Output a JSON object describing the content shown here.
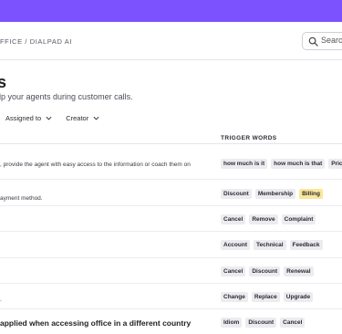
{
  "header": {
    "breadcrumb": "FFICE / DIALPAD AI",
    "search_placeholder": "Search"
  },
  "page": {
    "title": "ds",
    "subtitle": "elp your agents during customer calls."
  },
  "filters": {
    "assigned_label": "Assigned to",
    "creator_label": "Creator"
  },
  "table": {
    "trigger_header": "TRIGGER WORDS",
    "rows": [
      {
        "desc": ", provide the agent with easy access to the information or coach them on",
        "tags": [
          "how much is it",
          "how much is that",
          "Price"
        ],
        "highlight": -1
      },
      {
        "desc": "ayment method.",
        "tags": [
          "Discount",
          "Membership",
          "Billing"
        ],
        "highlight": 2
      },
      {
        "desc": "",
        "tags": [
          "Cancel",
          "Remove",
          "Complaint"
        ],
        "highlight": -1
      },
      {
        "desc": "",
        "tags": [
          "Account",
          "Technical",
          "Feedback"
        ],
        "highlight": -1
      },
      {
        "desc": "",
        "tags": [
          "Cancel",
          "Discount",
          "Renewal"
        ],
        "highlight": -1
      },
      {
        "desc": ".",
        "tags": [
          "Change",
          "Replace",
          "Upgrade"
        ],
        "highlight": -1
      },
      {
        "desc": "applied when accessing office in a different country",
        "tags": [
          "Idiom",
          "Discount",
          "Cancel"
        ],
        "highlight": -1
      }
    ]
  }
}
